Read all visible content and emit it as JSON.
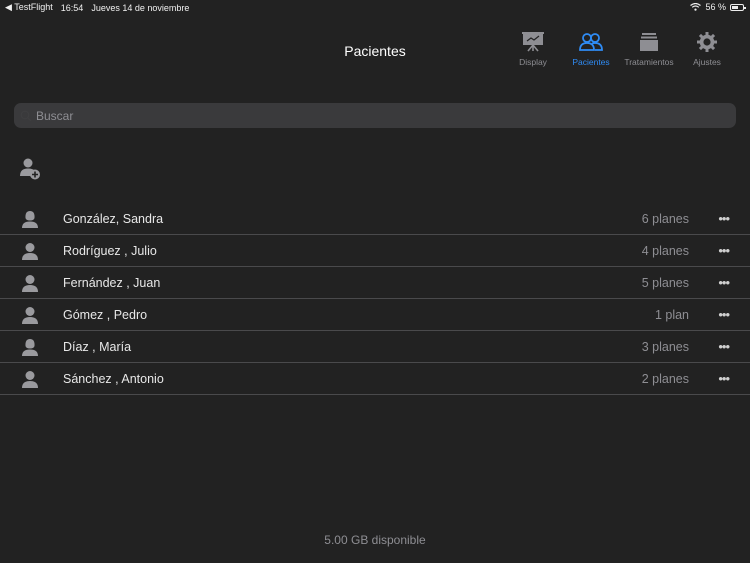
{
  "status_bar": {
    "back_app": "◀ TestFlight",
    "time": "16:54",
    "date": "Jueves 14 de noviembre",
    "battery": "56 %"
  },
  "nav": {
    "title": "Pacientes",
    "tabs": [
      {
        "label": "Display",
        "icon": "presentation-icon"
      },
      {
        "label": "Pacientes",
        "icon": "people-icon"
      },
      {
        "label": "Tratamientos",
        "icon": "stack-icon"
      },
      {
        "label": "Ajustes",
        "icon": "gear-icon"
      }
    ],
    "active_tab": "Pacientes"
  },
  "search": {
    "placeholder": "Buscar",
    "value": ""
  },
  "patients": [
    {
      "name": "González, Sandra",
      "plans": "6 planes",
      "avatar": "female"
    },
    {
      "name": "Rodríguez , Julio",
      "plans": "4 planes",
      "avatar": "male"
    },
    {
      "name": "Fernández , Juan",
      "plans": "5 planes",
      "avatar": "male"
    },
    {
      "name": "Gómez , Pedro",
      "plans": "1 plan",
      "avatar": "male"
    },
    {
      "name": "Díaz , María",
      "plans": "3 planes",
      "avatar": "female"
    },
    {
      "name": "Sánchez , Antonio",
      "plans": "2 planes",
      "avatar": "male"
    }
  ],
  "more_label": "•••",
  "footer": {
    "storage": "5.00 GB disponible"
  },
  "colors": {
    "background": "#222222",
    "accent": "#2f8cf5",
    "secondary_text": "#8e8e93",
    "separator": "#4a4a4c"
  }
}
